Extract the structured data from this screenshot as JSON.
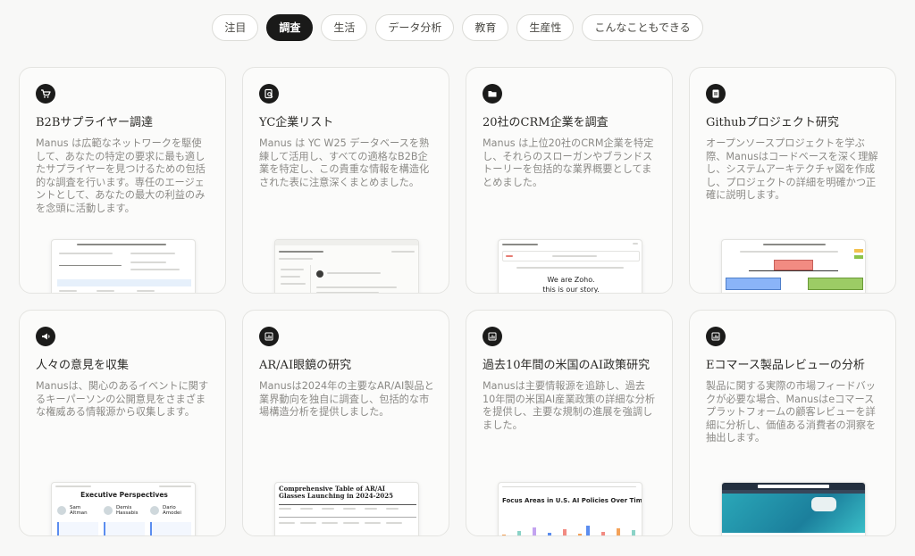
{
  "tabs": [
    {
      "label": "注目",
      "active": false
    },
    {
      "label": "調査",
      "active": true
    },
    {
      "label": "生活",
      "active": false
    },
    {
      "label": "データ分析",
      "active": false
    },
    {
      "label": "教育",
      "active": false
    },
    {
      "label": "生産性",
      "active": false
    },
    {
      "label": "こんなこともできる",
      "active": false
    }
  ],
  "cards": [
    {
      "icon": "cart-icon",
      "title": "B2Bサプライヤー調達",
      "desc": "Manus は広範なネットワークを駆使して、あなたの特定の要求に最も適したサプライヤーを見つけるための包括的な調査を行います。専任のエージェントとして、あなたの最大の利益のみを念頭に活動します。"
    },
    {
      "icon": "document-search-icon",
      "title": "YC企業リスト",
      "desc": "Manus は YC W25 データベースを熟練して活用し、すべての適格なB2B企業を特定し、この貴重な情報を構造化された表に注意深くまとめました。"
    },
    {
      "icon": "folder-icon",
      "title": "20社のCRM企業を調査",
      "desc": "Manus は上位20社のCRM企業を特定し、それらのスローガンやブランドストーリーを包括的な業界概要としてまとめました。"
    },
    {
      "icon": "file-icon",
      "title": "Githubプロジェクト研究",
      "desc": "オープンソースプロジェクトを学ぶ際、Manusはコードベースを深く理解し、システムアーキテクチャ図を作成し、プロジェクトの詳細を明確かつ正確に説明します。"
    },
    {
      "icon": "megaphone-icon",
      "title": "人々の意見を収集",
      "desc": "Manusは、関心のあるイベントに関するキーパーソンの公開意見をさまざまな権威ある情報源から収集します。"
    },
    {
      "icon": "chart-icon",
      "title": "AR/AI眼鏡の研究",
      "desc": "Manusは2024年の主要なAR/AI製品と業界動向を独自に調査し、包括的な市場構造分析を提供しました。"
    },
    {
      "icon": "chart-icon",
      "title": "過去10年間の米国のAI政策研究",
      "desc": "Manusは主要情報源を追跡し、過去10年間の米国AI産業政策の詳細な分析を提供し、主要な規制の進展を強調しました。"
    },
    {
      "icon": "chart-icon",
      "title": "Eコマース製品レビューの分析",
      "desc": "製品に関する実際の市場フィードバックが必要な場合、Manusはeコマースプラットフォームの顧客レビューを詳細に分析し、価値ある消費者の洞察を抽出します。"
    }
  ],
  "thumbs": {
    "crm_heading": "We are Zoho.",
    "crm_sub": "this is our story.",
    "opinion_heading": "Executive Perspectives",
    "opinion_names": [
      "Sam Altman",
      "Demis Hassabis",
      "Dario Amodei"
    ],
    "glasses_heading": "Comprehensive Table of AR/AI Glasses Launching in 2024-2025",
    "policy_heading": "Focus Areas in U.S. AI Policies Over Time"
  },
  "colors": {
    "active_tab": "#1a1a19",
    "node_red": "#f28b82",
    "node_blue": "#8ab4f8",
    "node_green": "#8bc34a",
    "bar_palette": [
      "#f4a259",
      "#5b8def",
      "#8bd3c7",
      "#f28b82",
      "#c3a3f0"
    ]
  }
}
